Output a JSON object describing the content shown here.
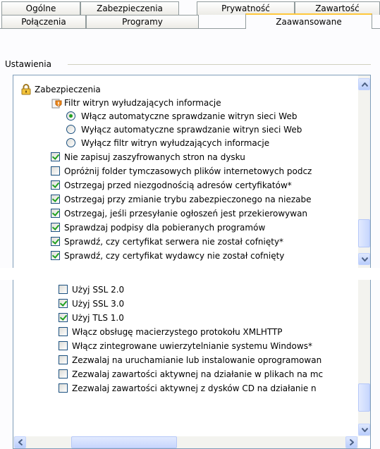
{
  "tabs_row1": [
    "Ogólne",
    "Zabezpieczenia",
    "Prywatność",
    "Zawartość"
  ],
  "tabs_row2": [
    "Połączenia",
    "Programy",
    "Zaawansowane"
  ],
  "settings_label": "Ustawienia",
  "list_top": [
    {
      "type": "category",
      "icon": "lock-icon",
      "label": "Zabezpieczenia"
    },
    {
      "type": "group",
      "icon": "shield-icon",
      "label": "Filtr witryn wyłudzających informacje"
    },
    {
      "type": "radio",
      "checked": true,
      "label": "Włącz automatyczne sprawdzanie witryn sieci Web"
    },
    {
      "type": "radio",
      "checked": false,
      "label": "Wyłącz automatyczne sprawdzanie witryn sieci Web"
    },
    {
      "type": "radio",
      "checked": false,
      "label": "Wyłącz filtr witryn wyłudzających informacje"
    },
    {
      "type": "check",
      "checked": true,
      "label": "Nie zapisuj zaszyfrowanych stron na dysku"
    },
    {
      "type": "check",
      "checked": false,
      "label": "Opróżnij folder tymczasowych plików internetowych podcz"
    },
    {
      "type": "check",
      "checked": true,
      "label": "Ostrzegaj przed niezgodnością adresów certyfikatów*"
    },
    {
      "type": "check",
      "checked": true,
      "label": "Ostrzegaj przy zmianie trybu zabezpieczonego na niezabe"
    },
    {
      "type": "check",
      "checked": true,
      "label": "Ostrzegaj, jeśli przesyłanie ogłoszeń jest przekierowywan"
    },
    {
      "type": "check",
      "checked": true,
      "label": "Sprawdzaj podpisy dla pobieranych programów"
    },
    {
      "type": "check",
      "checked": true,
      "label": "Sprawdź, czy certyfikat serwera nie został cofnięty*"
    },
    {
      "type": "check",
      "checked": true,
      "label": "Sprawdź, czy certyfikat wydawcy nie został cofnięty"
    }
  ],
  "list_bottom": [
    {
      "type": "check",
      "checked": false,
      "label": "Użyj SSL 2.0"
    },
    {
      "type": "check",
      "checked": true,
      "label": "Użyj SSL 3.0"
    },
    {
      "type": "check",
      "checked": true,
      "label": "Użyj TLS 1.0"
    },
    {
      "type": "check",
      "checked": false,
      "label": "Włącz obsługę macierzystego protokołu XMLHTTP"
    },
    {
      "type": "check",
      "checked": false,
      "label": "Włącz zintegrowane uwierzytelnianie systemu Windows*"
    },
    {
      "type": "check",
      "checked": false,
      "label": "Zezwalaj na uruchamianie lub instalowanie oprogramowan"
    },
    {
      "type": "check",
      "checked": false,
      "label": "Zezwalaj zawartości aktywnej na działanie w plikach na mc"
    },
    {
      "type": "check",
      "checked": false,
      "label": "Zezwalaj zawartości aktywnej z dysków CD na działanie n"
    }
  ],
  "colors": {
    "tab_highlight": "#ffc83c",
    "check_mark": "#21a121",
    "control_border": "#1c5180"
  }
}
